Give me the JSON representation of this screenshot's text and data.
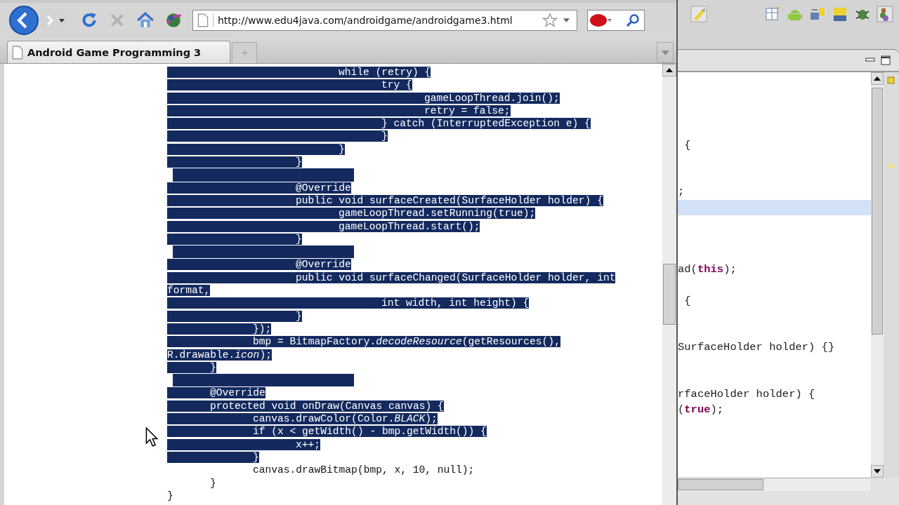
{
  "browser": {
    "url": "http://www.edu4java.com/androidgame/androidgame3.html",
    "tabs": [
      {
        "title": "Android Game Programming 3",
        "selected": true
      }
    ],
    "code_lines": [
      {
        "text": "\t\t\t\twhile (retry) {",
        "selected": true
      },
      {
        "text": "\t\t\t\t\ttry {",
        "selected": true
      },
      {
        "text": "\t\t\t\t\t\tgameLoopThread.join();",
        "selected": true
      },
      {
        "text": "\t\t\t\t\t\tretry = false;",
        "selected": true
      },
      {
        "text": "\t\t\t\t\t} catch (InterruptedException e) {",
        "selected": true
      },
      {
        "text": "\t\t\t\t\t}",
        "selected": true
      },
      {
        "text": "\t\t\t\t}",
        "selected": true
      },
      {
        "text": "\t\t\t}",
        "selected": true
      },
      {
        "selected": true
      },
      {
        "text": "\t\t\t@Override",
        "selected": true
      },
      {
        "text": "\t\t\tpublic void surfaceCreated(SurfaceHolder holder) {",
        "selected": true
      },
      {
        "text": "\t\t\t\tgameLoopThread.setRunning(true);",
        "selected": true
      },
      {
        "text": "\t\t\t\tgameLoopThread.start();",
        "selected": true
      },
      {
        "text": "\t\t\t}",
        "selected": true
      },
      {
        "selected": true
      },
      {
        "text": "\t\t\t@Override",
        "selected": true
      },
      {
        "text": "\t\t\tpublic void surfaceChanged(SurfaceHolder holder, int",
        "selected": true
      },
      {
        "text": "format,",
        "selected": true
      },
      {
        "text": "\t\t\t\t\tint width, int height) {",
        "selected": true
      },
      {
        "text": "\t\t\t}",
        "selected": true
      },
      {
        "text": "\t\t});",
        "selected": true
      },
      {
        "text": "\t\tbmp = BitmapFactory.*decodeResource*(getResources(),",
        "selected": true
      },
      {
        "text": "R.drawable.*icon*);",
        "selected": true
      },
      {
        "text": "\t}",
        "selected": true
      },
      {
        "selected": true
      },
      {
        "text": "\t@Override",
        "selected": true
      },
      {
        "text": "\tprotected void onDraw(Canvas canvas) {",
        "selected": true
      },
      {
        "text": "\t\tcanvas.drawColor(Color.*BLACK*);",
        "selected": true
      },
      {
        "text": "\t\tif (x < getWidth() - bmp.getWidth()) {",
        "selected": true
      },
      {
        "text": "\t\t\tx++;",
        "selected": true
      },
      {
        "text": "\t\t}",
        "selected": true
      },
      {
        "text": "\t\tcanvas.drawBitmap(bmp, x, 10, null);",
        "selected": false
      },
      {
        "text": "\t}",
        "selected": false
      },
      {
        "text": "}",
        "selected": false
      }
    ]
  },
  "ide": {
    "code_lines": [
      {
        "current": false
      },
      {
        "current": false
      },
      {
        "current": false
      },
      {
        "current": false
      },
      {
        "text": " {",
        "current": false
      },
      {
        "current": false
      },
      {
        "current": false
      },
      {
        "text": ";",
        "current": false
      },
      {
        "current": true
      },
      {
        "current": false
      },
      {
        "current": false
      },
      {
        "current": false
      },
      {
        "text": "ad(**this**);",
        "current": false
      },
      {
        "current": false
      },
      {
        "text": " {",
        "current": false
      },
      {
        "current": false
      },
      {
        "current": false
      },
      {
        "text": "SurfaceHolder holder) {}",
        "current": false
      },
      {
        "current": false
      },
      {
        "current": false
      },
      {
        "text": "rfaceHolder holder) {",
        "current": false
      },
      {
        "text": "(**true**);",
        "current": false
      }
    ]
  }
}
